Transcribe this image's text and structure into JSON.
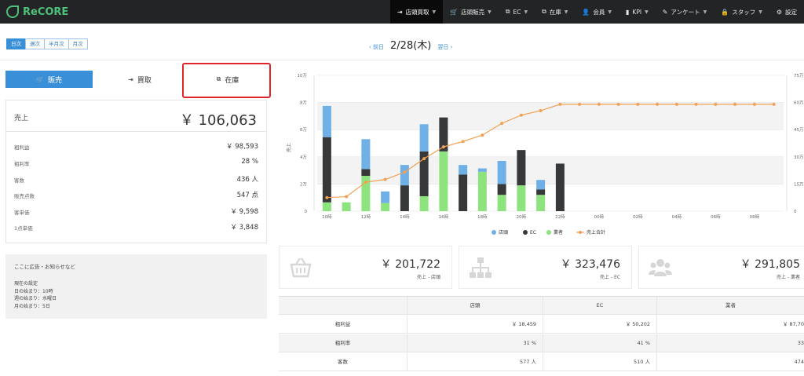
{
  "app": {
    "logo_text": "ReCORE"
  },
  "nav": [
    {
      "icon": "⇥",
      "label": "店頭買取",
      "active": true
    },
    {
      "icon": "🛒",
      "label": "店頭販売"
    },
    {
      "icon": "⧉",
      "label": "EC"
    },
    {
      "icon": "⧉",
      "label": "在庫"
    },
    {
      "icon": "👤",
      "label": "会員"
    },
    {
      "icon": "▮",
      "label": "KPI"
    },
    {
      "icon": "✎",
      "label": "アンケート"
    },
    {
      "icon": "🔒",
      "label": "スタッフ"
    },
    {
      "icon": "⚙",
      "label": "設定"
    }
  ],
  "periods": [
    "日次",
    "週次",
    "半月次",
    "月次"
  ],
  "date_nav": {
    "prev": "‹ 前日",
    "date": "2/28(木)",
    "next": "翌日 ›"
  },
  "tabs": {
    "sell": "販売",
    "buy": "買取",
    "stock": "在庫"
  },
  "summary": {
    "head_label": "売上",
    "head_value": "￥ 106,063",
    "rows": [
      {
        "label": "粗利益",
        "value": "￥ 98,593"
      },
      {
        "label": "粗利率",
        "value": "28 %"
      },
      {
        "label": "客数",
        "value": "436 人"
      },
      {
        "label": "販売点数",
        "value": "547 点"
      },
      {
        "label": "客単価",
        "value": "￥ 9,598"
      },
      {
        "label": "1点単価",
        "value": "￥ 3,848"
      }
    ]
  },
  "notice": {
    "title": "ここに広告・お知らせなど",
    "lines": [
      "現在の設定",
      "日の始まり：10時",
      "週の始まり：水曜日",
      "月の始まり：5日"
    ]
  },
  "chart_data": {
    "type": "bar",
    "categories": [
      "10時",
      "11時",
      "12時",
      "13時",
      "14時",
      "15時",
      "16時",
      "17時",
      "18時",
      "19時",
      "20時",
      "21時",
      "22時",
      "23時",
      "00時",
      "01時",
      "02時",
      "03時",
      "04時",
      "05時",
      "06時",
      "07時",
      "08時",
      "09時"
    ],
    "x_tick_labels": [
      "10時",
      "12時",
      "14時",
      "16時",
      "18時",
      "20時",
      "22時",
      "00時",
      "02時",
      "04時",
      "06時",
      "08時"
    ],
    "y_left_ticks": [
      "0",
      "2万",
      "4万",
      "6万",
      "8万",
      "10万"
    ],
    "y_right_ticks": [
      "0",
      "15万",
      "30万",
      "45万",
      "60万",
      "75万"
    ],
    "ylabel": "売上",
    "ylim": [
      0,
      100000
    ],
    "y2lim": [
      0,
      750000
    ],
    "stacked": true,
    "series": [
      {
        "name": "店頭",
        "color": "#6fb0e6",
        "values": [
          23000,
          0,
          22000,
          8500,
          15000,
          20000,
          0,
          7000,
          2500,
          17000,
          0,
          7000,
          0,
          0,
          0,
          0,
          0,
          0,
          0,
          0,
          0,
          0,
          0,
          0
        ]
      },
      {
        "name": "EC",
        "color": "#363839",
        "values": [
          48000,
          0,
          5000,
          0,
          19000,
          33000,
          25000,
          27000,
          0,
          8000,
          26000,
          4000,
          35000,
          0,
          0,
          0,
          0,
          0,
          0,
          0,
          0,
          0,
          0,
          0
        ]
      },
      {
        "name": "業者",
        "color": "#8de37e",
        "values": [
          6500,
          6500,
          26000,
          6000,
          0,
          11000,
          44000,
          0,
          29000,
          12000,
          19000,
          12000,
          0,
          0,
          0,
          0,
          0,
          0,
          0,
          0,
          0,
          0,
          0,
          0
        ]
      },
      {
        "name": "売上合計",
        "type": "line",
        "axis": "right",
        "color": "#f2a154",
        "values": [
          75000,
          80000,
          160000,
          175000,
          215000,
          290000,
          355000,
          385000,
          420000,
          485000,
          530000,
          555000,
          590000,
          590000,
          590000,
          590000,
          590000,
          590000,
          590000,
          590000,
          590000,
          590000,
          590000,
          590000
        ]
      }
    ],
    "legend_position": "bottom",
    "grid": true
  },
  "kpis": [
    {
      "icon": "basket-icon",
      "value": "￥ 201,722",
      "label": "売上 - 店頭"
    },
    {
      "icon": "sitemap-icon",
      "value": "￥ 323,476",
      "label": "売上 - EC"
    },
    {
      "icon": "users-icon",
      "value": "￥ 291,805",
      "label": "売上 - 業者"
    }
  ],
  "table": {
    "headers": [
      "",
      "店頭",
      "EC",
      "業者"
    ],
    "rows": [
      [
        "粗利益",
        "￥ 18,459",
        "￥ 50,202",
        "￥ 87,70"
      ],
      [
        "粗利率",
        "31 %",
        "41 %",
        "33"
      ],
      [
        "客数",
        "577 人",
        "510 人",
        "474"
      ]
    ]
  }
}
